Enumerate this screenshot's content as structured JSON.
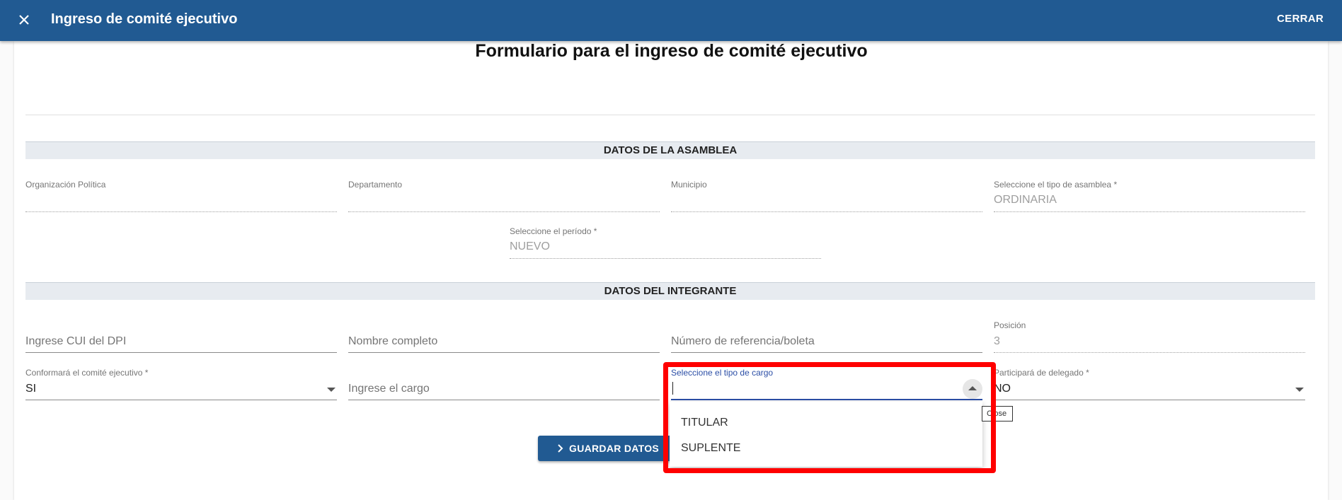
{
  "appbar": {
    "title": "Ingreso de comité ejecutivo",
    "close_label": "CERRAR"
  },
  "form": {
    "title": "Formulario para el ingreso de comité ejecutivo"
  },
  "sections": {
    "asamblea": "DATOS DE LA ASAMBLEA",
    "integrante": "DATOS DEL INTEGRANTE"
  },
  "asamblea": {
    "organizacion": {
      "label": "Organización Política",
      "value": ""
    },
    "departamento": {
      "label": "Departamento",
      "value": ""
    },
    "municipio": {
      "label": "Municipio",
      "value": ""
    },
    "tipo_asamblea": {
      "label": "Seleccione el tipo de asamblea *",
      "value": "ORDINARIA"
    },
    "periodo": {
      "label": "Seleccione el período *",
      "value": "NUEVO"
    }
  },
  "integrante": {
    "cui": {
      "placeholder": "Ingrese CUI del DPI"
    },
    "nombre": {
      "placeholder": "Nombre completo"
    },
    "referencia": {
      "placeholder": "Número de referencia/boleta"
    },
    "posicion": {
      "label": "Posición",
      "value": "3"
    },
    "conformara": {
      "label": "Conformará el comité ejecutivo *",
      "value": "SI"
    },
    "cargo": {
      "placeholder": "Ingrese el cargo"
    },
    "tipo_cargo": {
      "label": "Seleccione el tipo de cargo",
      "value": ""
    },
    "delegado": {
      "label": "Participará de delegado *",
      "value": "NO"
    }
  },
  "dropdown": {
    "options": [
      "TITULAR",
      "SUPLENTE"
    ],
    "tooltip": "Close"
  },
  "actions": {
    "save_label": "GUARDAR DATOS"
  },
  "colors": {
    "primary": "#215a92",
    "focus": "#2b4ea6",
    "highlight": "#ff0000"
  }
}
